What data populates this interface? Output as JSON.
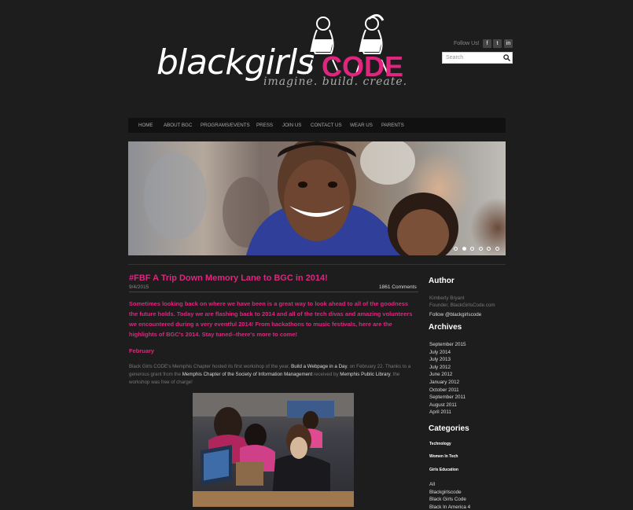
{
  "header": {
    "logo": {
      "black": "black",
      "girls": "girls",
      "code": "CODE",
      "tagline": "imagine. build. create."
    },
    "follow_label": "Follow Us!",
    "social": [
      {
        "icon": "facebook-icon",
        "glyph": "f"
      },
      {
        "icon": "twitter-icon",
        "glyph": "t"
      },
      {
        "icon": "linkedin-icon",
        "glyph": "in"
      }
    ],
    "search": {
      "placeholder": "Search"
    }
  },
  "nav": {
    "items": [
      "HOME",
      "ABOUT BGC",
      "PROGRAMS/EVENTS",
      "PRESS",
      "JOIN US",
      "CONTACT US",
      "WEAR US",
      "PARENTS"
    ]
  },
  "slider": {
    "dots": 6,
    "active_index": 2
  },
  "post": {
    "title": "#FBF A Trip Down Memory Lane to BGC in 2014!",
    "date": "9/4/2015",
    "comments": "1861 Comments",
    "intro": "Sometimes looking back on where we have been is a great way to look ahead to all of the goodness the future holds. Today we are flashing back  to 2014 and all of the tech divas and amazing volunteers we encountered during a very eventful 2014! From hackathons to music festivals, here are the highlights of BGC's 2014. Stay tuned--there's more to come!",
    "month": "February",
    "para": {
      "p1": "Black Girls CODE's Memphis Chapter hosted its first workshop of the year, ",
      "l1": "Build a Webpage in a Day",
      "p2": ", on February 22. Thanks to a generous grant from the ",
      "l2": "Memphis Chapter of the Society of Information Management",
      "p3": " received by ",
      "l3": "Memphis Public Library",
      "p4": ", the workshop was free of charge!"
    }
  },
  "sidebar": {
    "author_heading": "Author",
    "author_name": "Kimberly Bryant",
    "author_role": "Founder, BlackGirlsCode.com",
    "author_follow": "Follow @blackgirlscode",
    "archives_heading": "Archives",
    "archives": [
      "September 2015",
      "July 2014",
      "July 2013",
      "July 2012",
      "June 2012",
      "January 2012",
      "October 2011",
      "September 2011",
      "August 2011",
      "April 2011"
    ],
    "categories_heading": "Categories",
    "categories_bold": [
      "Technology",
      "Women In Tech",
      "Girls Education"
    ],
    "categories": [
      "All",
      "Blackgirlscode",
      "Black Girls Code",
      "Black In America 4"
    ]
  },
  "colors": {
    "accent": "#e0257f",
    "background": "#1d1d1d"
  }
}
